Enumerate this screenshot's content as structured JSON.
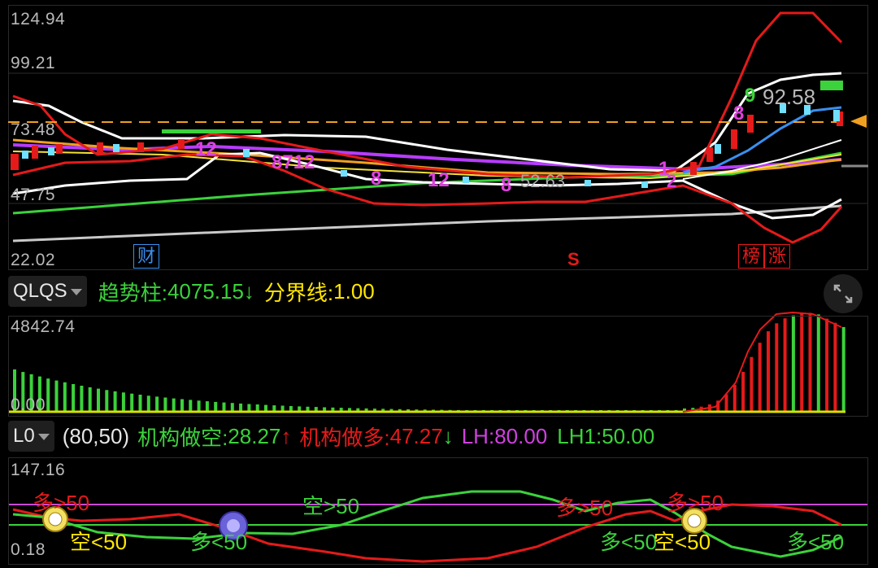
{
  "main": {
    "y_labels": [
      "124.94",
      "99.21",
      "73.48",
      "47.75",
      "22.02"
    ],
    "price_labels": [
      "92.58",
      "52.63"
    ],
    "markers": {
      "cai": "财",
      "s": "S",
      "bang": "榜",
      "zhang": "涨"
    },
    "count_labels": [
      "12",
      "8712",
      "8",
      "12",
      "8",
      "1",
      "2",
      "8",
      "9",
      "12"
    ]
  },
  "indicator1": {
    "name": "QLQS",
    "trend_label": "趋势柱:",
    "trend_value": "4075.15",
    "trend_arrow": "↓",
    "boundary_label": "分界线:",
    "boundary_value": "1.00",
    "y_max": "4842.74",
    "y_min": "0.00"
  },
  "indicator2": {
    "name": "L0",
    "params": "(80,50)",
    "short_label": "机构做空:",
    "short_value": "28.27",
    "short_arrow": "↑",
    "long_label": "机构做多:",
    "long_value": "47.27",
    "long_arrow": "↓",
    "lh_label": "LH:",
    "lh_value": "80.00",
    "lh1_label": "LH1:",
    "lh1_value": "50.00",
    "y_max": "147.16",
    "y_min": "0.18",
    "annotations": [
      "多>50",
      "空<50",
      "多<50",
      "空>50",
      "多>50",
      "多<50",
      "空<50",
      "多>50",
      "多<50"
    ]
  },
  "colors": {
    "background": "#000000",
    "up": "#ff2a2a",
    "down": "#36d93a",
    "orange_dash": "#f0a020",
    "purple": "#b83cff",
    "magenta_text": "#e040e0",
    "yellow": "#ffe600"
  }
}
